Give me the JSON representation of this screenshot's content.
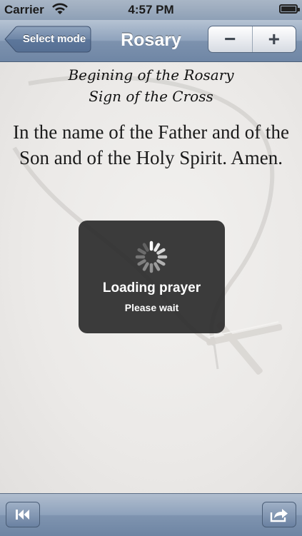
{
  "status_bar": {
    "carrier": "Carrier",
    "time": "4:57 PM",
    "wifi_icon": "wifi-icon",
    "battery_icon": "battery-icon"
  },
  "nav": {
    "back_label": "Select mode",
    "title": "Rosary",
    "decrease_label": "−",
    "increase_label": "+"
  },
  "content": {
    "heading_line1": "Begining of the Rosary",
    "heading_line2": "Sign of the Cross",
    "prayer_text": "In the name of the Father and of the Son and of the Holy Spirit. Amen."
  },
  "hud": {
    "title": "Loading prayer",
    "subtitle": "Please wait",
    "icon": "spinner-icon"
  },
  "toolbar": {
    "left_icon": "rewind-to-start-icon",
    "right_icon": "share-icon"
  }
}
